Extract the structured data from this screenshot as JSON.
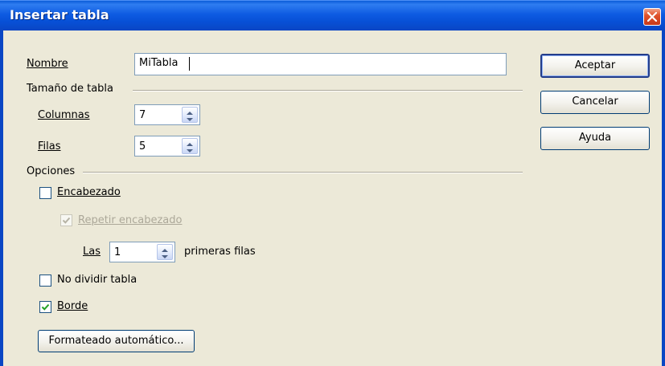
{
  "window": {
    "title": "Insertar tabla"
  },
  "name": {
    "label": "Nombre",
    "value": "MiTabla"
  },
  "table_size": {
    "heading": "Tamaño de tabla",
    "columns": {
      "label": "Columnas",
      "value": "7"
    },
    "rows": {
      "label": "Filas",
      "value": "5"
    }
  },
  "options": {
    "heading": "Opciones",
    "heading_cb": {
      "label": "Encabezado",
      "checked": false
    },
    "repeat_heading": {
      "label": "Repetir encabezado",
      "checked": true,
      "disabled": true
    },
    "rows_prefix": "Las",
    "rows_value": "1",
    "rows_suffix": "primeras filas",
    "dont_split": {
      "label": "No dividir tabla",
      "checked": false
    },
    "border": {
      "label": "Borde",
      "checked": true
    },
    "autoformat_label": "Formateado automático..."
  },
  "buttons": {
    "ok": "Aceptar",
    "cancel": "Cancelar",
    "help": "Ayuda"
  },
  "icons": [
    "close-icon",
    "spin-arrows-icon",
    "checkmark-icon"
  ]
}
